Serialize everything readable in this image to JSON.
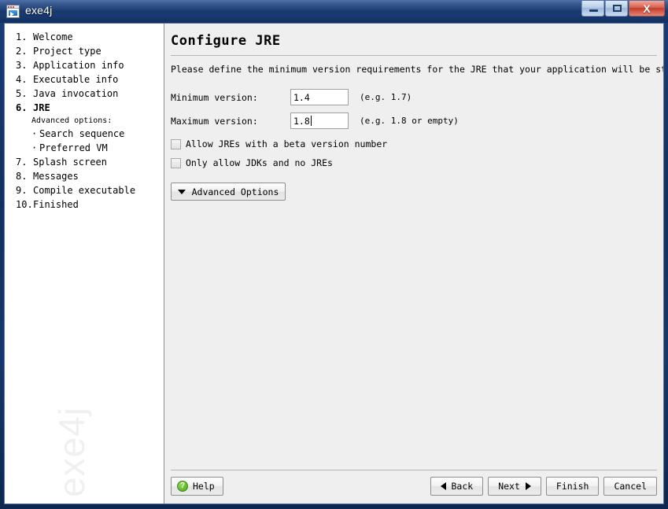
{
  "window": {
    "title": "exe4j",
    "icon": "app-window-icon",
    "controls": {
      "minimize": "minimize-icon",
      "maximize": "maximize-icon",
      "close": "X"
    }
  },
  "sidebar": {
    "items": [
      {
        "num": "1.",
        "label": "Welcome",
        "current": false
      },
      {
        "num": "2.",
        "label": "Project type",
        "current": false
      },
      {
        "num": "3.",
        "label": "Application info",
        "current": false
      },
      {
        "num": "4.",
        "label": "Executable info",
        "current": false
      },
      {
        "num": "5.",
        "label": "Java invocation",
        "current": false
      },
      {
        "num": "6.",
        "label": "JRE",
        "current": true
      }
    ],
    "sub_heading": "Advanced options:",
    "sub_items": [
      {
        "bullet": "·",
        "label": "Search sequence"
      },
      {
        "bullet": "·",
        "label": "Preferred VM"
      }
    ],
    "items_after": [
      {
        "num": "7.",
        "label": "Splash screen",
        "current": false
      },
      {
        "num": "8.",
        "label": "Messages",
        "current": false
      },
      {
        "num": "9.",
        "label": "Compile executable",
        "current": false
      },
      {
        "num": "10.",
        "label": "Finished",
        "current": false
      }
    ],
    "watermark": "exe4j"
  },
  "main": {
    "page_title": "Configure JRE",
    "description": "Please define the minimum version requirements for the JRE that your application will be started with.",
    "fields": [
      {
        "label": "Minimum version:",
        "value": "1.4",
        "hint": "(e.g. 1.7)",
        "focused": false
      },
      {
        "label": "Maximum version:",
        "value": "1.8",
        "hint": "(e.g. 1.8 or empty)",
        "focused": true
      }
    ],
    "checkboxes": [
      {
        "label": "Allow JREs with a beta version number",
        "checked": false
      },
      {
        "label": "Only allow JDKs and no JREs",
        "checked": false
      }
    ],
    "advanced_button": "Advanced Options"
  },
  "footer": {
    "help": "Help",
    "help_glyph": "?",
    "back": "Back",
    "next": "Next",
    "finish": "Finish",
    "cancel": "Cancel"
  },
  "colors": {
    "titlebar": "#17376d",
    "accent_green": "#4ea520",
    "close_red": "#c23c2b",
    "panel_bg": "#efefef",
    "sidebar_bg": "#ffffff"
  }
}
